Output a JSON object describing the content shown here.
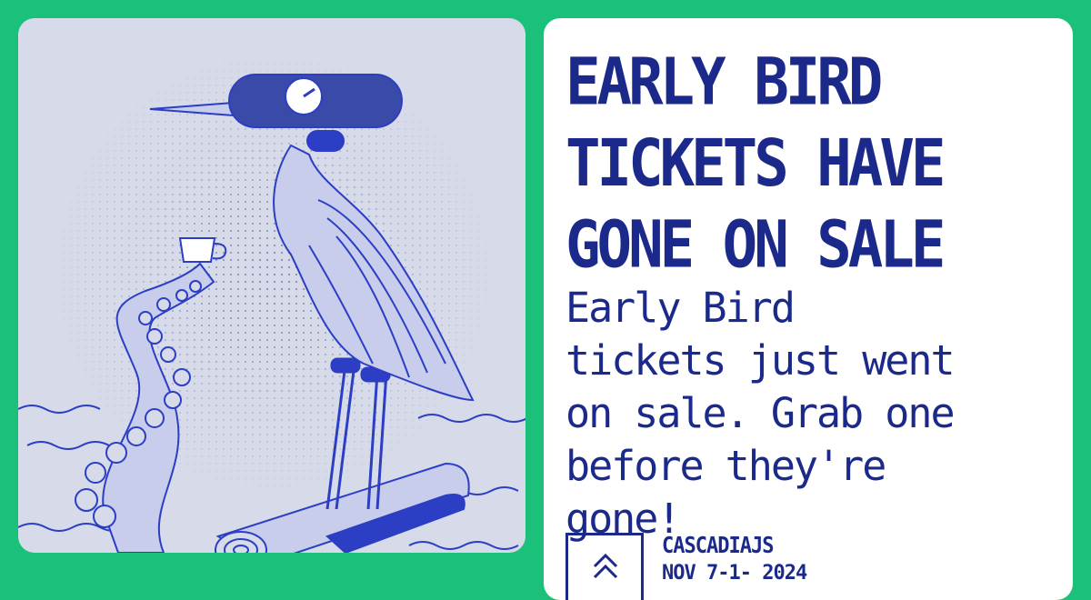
{
  "colors": {
    "background": "#1bc07a",
    "panel": "#ffffff",
    "ink": "#1b2a8a",
    "art_bg": "#d7dbe9",
    "art_line": "#2b3ec4"
  },
  "headline": {
    "lines": [
      "EARLY BIRD",
      "TICKETS HAVE",
      "GONE ON SALE"
    ]
  },
  "body": {
    "lines": [
      "Early Bird",
      "tickets just went",
      "on sale. Grab one",
      "before they're",
      "gone!"
    ]
  },
  "footer": {
    "logo_icon": "chevrons-up-icon",
    "brand": "CASCADIAJS",
    "date_partial": "NOV 7-1- 2024"
  },
  "illustration": {
    "icon": "heron-on-log-with-octopus-illustration"
  }
}
